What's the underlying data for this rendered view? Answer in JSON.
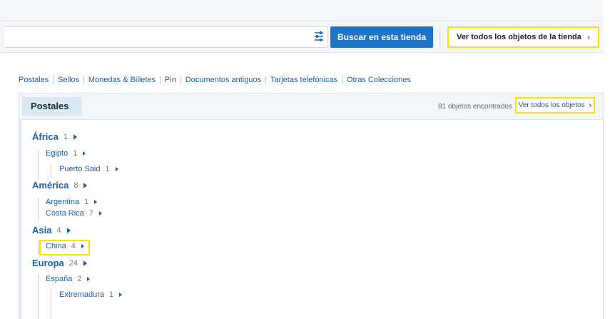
{
  "search": {
    "input_value": "",
    "filter_icon": "sliders-icon",
    "button_label": "Buscar en esta tienda",
    "view_all_store_label": "Ver todos los objetos de la tienda",
    "chevron": "›"
  },
  "categories": [
    "Postales",
    "Sellos",
    "Monedas & Billetes",
    "Pin",
    "Documentos antiguos",
    "Tarjetas telefónicas",
    "Otras Colecciones"
  ],
  "panel": {
    "tab_label": "Postales",
    "found_text": "81 objetos encontrados",
    "view_all_label": "Ver todos los objetos",
    "chevron": "›"
  },
  "tree": [
    {
      "name": "África",
      "count": "1"
    },
    {
      "name": "Egipto",
      "count": "1"
    },
    {
      "name": "Puerto Said",
      "count": "1"
    },
    {
      "name": "América",
      "count": "8"
    },
    {
      "name": "Argentina",
      "count": "1"
    },
    {
      "name": "Costa Rica",
      "count": "7"
    },
    {
      "name": "Asia",
      "count": "4"
    },
    {
      "name": "China",
      "count": "4"
    },
    {
      "name": "Europa",
      "count": "24"
    },
    {
      "name": "España",
      "count": "2"
    },
    {
      "name": "Extremadura",
      "count": "1"
    }
  ]
}
